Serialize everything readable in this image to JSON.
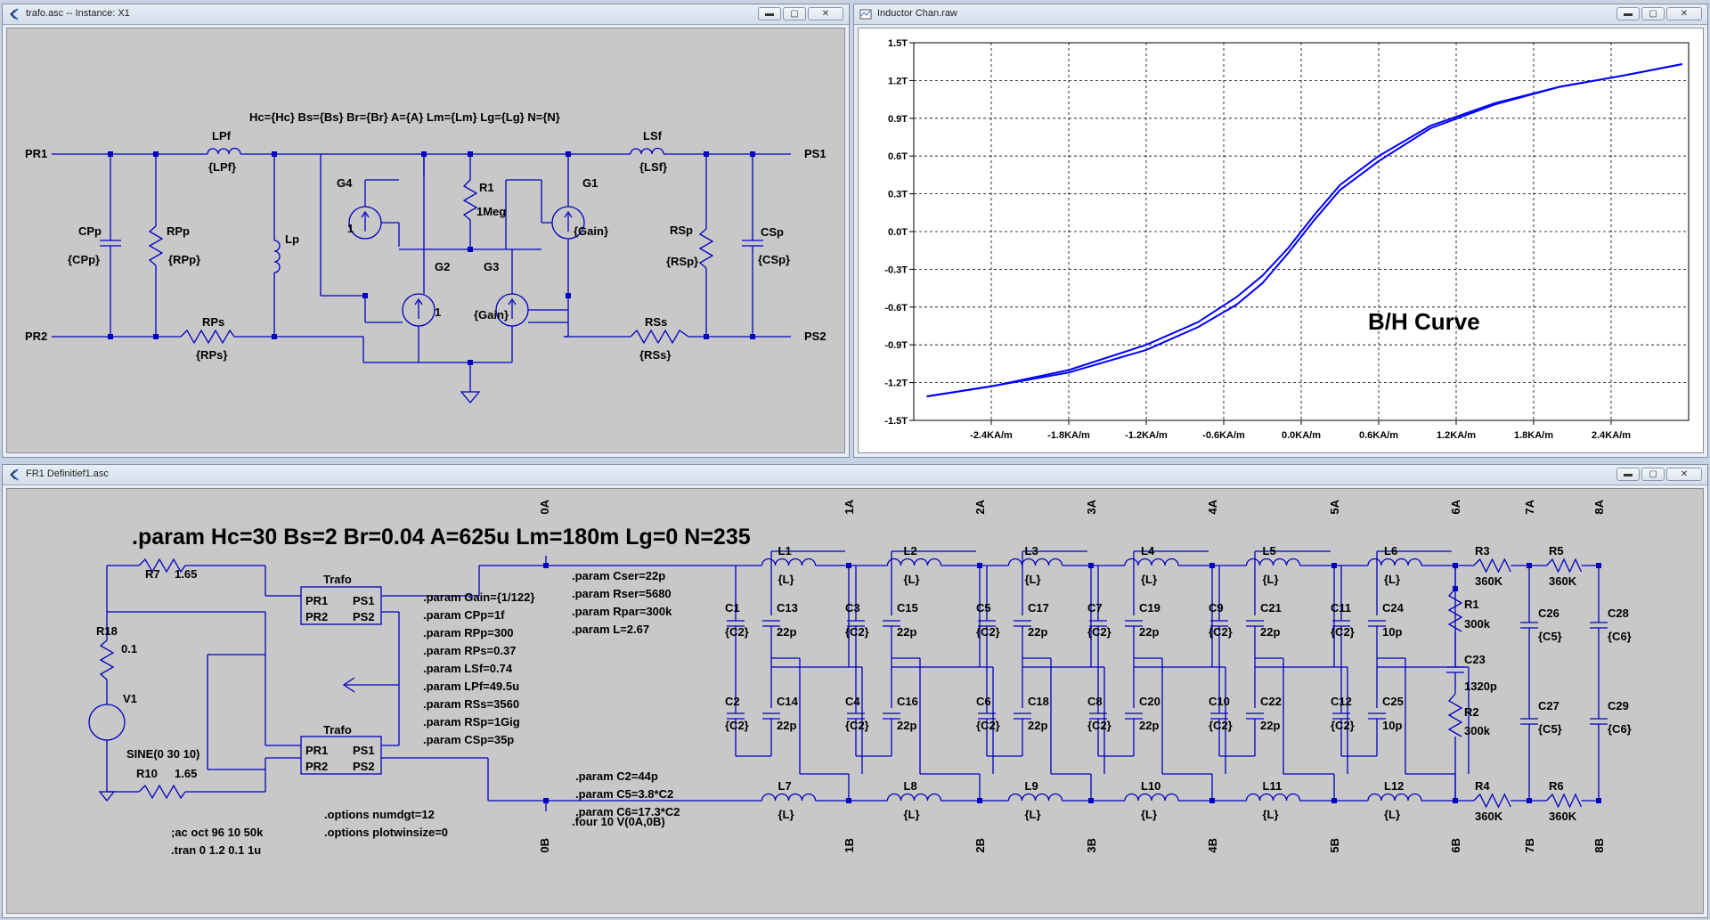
{
  "windows": {
    "trafo": {
      "title": "trafo.asc -- Instance: X1"
    },
    "plot": {
      "title": "Inductor Chan.raw"
    },
    "fr1": {
      "title": "FR1 Definitief1.asc"
    }
  },
  "window_buttons": {
    "minimize": "▬",
    "maximize": "▢",
    "close": "✕"
  },
  "trafo": {
    "header": "Hc={Hc} Bs={Bs} Br={Br} A={A} Lm={Lm} Lg={Lg} N={N}",
    "ports": {
      "pr1": "PR1",
      "pr2": "PR2",
      "ps1": "PS1",
      "ps2": "PS2"
    },
    "LPf": {
      "name": "LPf",
      "value": "{LPf}"
    },
    "LSf": {
      "name": "LSf",
      "value": "{LSf}"
    },
    "CPp": {
      "name": "CPp",
      "value": "{CPp}"
    },
    "RPp": {
      "name": "RPp",
      "value": "{RPp}"
    },
    "Lp": {
      "name": "Lp"
    },
    "RPs": {
      "name": "RPs",
      "value": "{RPs}"
    },
    "RSs": {
      "name": "RSs",
      "value": "{RSs}"
    },
    "RSp": {
      "name": "RSp",
      "value": "{RSp}"
    },
    "CSp": {
      "name": "CSp",
      "value": "{CSp}"
    },
    "R1": {
      "name": "R1",
      "value": "1Meg"
    },
    "G1": {
      "name": "G1",
      "value": "{Gain}"
    },
    "G2": {
      "name": "G2",
      "value": "1"
    },
    "G3": {
      "name": "G3",
      "value": "{Gain}"
    },
    "G4": {
      "name": "G4",
      "value": "1"
    }
  },
  "plot": {
    "annotation": "B/H Curve",
    "annotation_color": "#1fa01f",
    "trace_color": "#0000ff"
  },
  "chart_data": {
    "type": "line",
    "title": "",
    "xlabel": "",
    "ylabel": "",
    "xlim": [
      -3.0,
      3.0
    ],
    "ylim": [
      -1.5,
      1.5
    ],
    "x_unit": "KA/m",
    "y_unit": "T",
    "grid": true,
    "x_ticks": [
      "-2.4KA/m",
      "-1.8KA/m",
      "-1.2KA/m",
      "-0.6KA/m",
      "0.0KA/m",
      "0.6KA/m",
      "1.2KA/m",
      "1.8KA/m",
      "2.4KA/m"
    ],
    "y_ticks": [
      "1.5T",
      "1.2T",
      "0.9T",
      "0.6T",
      "0.3T",
      "0.0T",
      "-0.3T",
      "-0.6T",
      "-0.9T",
      "-1.2T",
      "-1.5T"
    ],
    "series": [
      {
        "x": [
          -2.9,
          -2.4,
          -1.8,
          -1.2,
          -0.8,
          -0.5,
          -0.3,
          -0.1,
          0.0,
          0.1,
          0.3,
          0.6,
          1.0,
          1.5,
          2.0,
          2.5,
          2.95
        ],
        "y": [
          -1.31,
          -1.23,
          -1.1,
          -0.9,
          -0.72,
          -0.52,
          -0.35,
          -0.13,
          0.0,
          0.13,
          0.37,
          0.6,
          0.84,
          1.02,
          1.15,
          1.24,
          1.33
        ]
      },
      {
        "x": [
          -2.9,
          -2.4,
          -1.8,
          -1.2,
          -0.8,
          -0.5,
          -0.3,
          -0.1,
          0.0,
          0.1,
          0.3,
          0.6,
          1.0,
          1.5,
          2.0,
          2.5,
          2.95
        ],
        "y": [
          -1.31,
          -1.23,
          -1.12,
          -0.94,
          -0.76,
          -0.58,
          -0.41,
          -0.17,
          -0.04,
          0.09,
          0.33,
          0.56,
          0.82,
          1.01,
          1.15,
          1.24,
          1.33
        ]
      }
    ]
  },
  "fr1": {
    "param_main": ".param Hc=30 Bs=2 Br=0.04 A=625u Lm=180m Lg=0 N=235",
    "trafo_label": "Trafo",
    "pins": {
      "pr1": "PR1",
      "pr2": "PR2",
      "ps1": "PS1",
      "ps2": "PS2"
    },
    "R7": {
      "name": "R7",
      "value": "1.65"
    },
    "R18": {
      "name": "R18",
      "value": "0.1"
    },
    "V1": {
      "name": "V1",
      "value": "SINE(0 30 10)"
    },
    "R10": {
      "name": "R10",
      "value": "1.65"
    },
    "params_trafo": [
      ".param Gain={1/122}",
      ".param CPp=1f",
      ".param RPp=300",
      ".param RPs=0.37",
      ".param LSf=0.74",
      ".param LPf=49.5u",
      ".param RSs=3560",
      ".param RSp=1Gig",
      ".param CSp=35p"
    ],
    "params_c": [
      ".param Cser=22p",
      ".param Rser=5680",
      ".param Rpar=300k",
      ".param L=2.67"
    ],
    "params_c2": [
      ".param C2=44p",
      ".param C5=3.8*C2",
      ".param C6=17.3*C2"
    ],
    "four": ".four 10 V(0A,0B)",
    "ac": ";ac oct 96 10 50k",
    "tran": ".tran 0 1.2 0.1 1u",
    "opt1": ".options numdgt=12",
    "opt2": ".options plotwinsize=0",
    "nodes_top": [
      "0A",
      "1A",
      "2A",
      "3A",
      "4A",
      "5A",
      "6A",
      "7A",
      "8A"
    ],
    "nodes_bottom": [
      "0B",
      "1B",
      "2B",
      "3B",
      "4B",
      "5B",
      "6B",
      "7B",
      "8B"
    ],
    "L_top": [
      "L1",
      "L2",
      "L3",
      "L4",
      "L5",
      "L6"
    ],
    "L_bot": [
      "L7",
      "L8",
      "L9",
      "L10",
      "L11",
      "L12"
    ],
    "L_value": "{L}",
    "sections": [
      {
        "ca": "C1",
        "cb": "C13",
        "cc": "C2",
        "cd": "C14",
        "va": "{C2}",
        "vb": "22p",
        "vd": "22p"
      },
      {
        "ca": "C3",
        "cb": "C15",
        "cc": "C4",
        "cd": "C16",
        "va": "{C2}",
        "vb": "22p",
        "vd": "22p"
      },
      {
        "ca": "C5",
        "cb": "C17",
        "cc": "C6",
        "cd": "C18",
        "va": "{C2}",
        "vb": "22p",
        "vd": "22p"
      },
      {
        "ca": "C7",
        "cb": "C19",
        "cc": "C8",
        "cd": "C20",
        "va": "{C2}",
        "vb": "22p",
        "vd": "22p"
      },
      {
        "ca": "C9",
        "cb": "C21",
        "cc": "C10",
        "cd": "C22",
        "va": "{C2}",
        "vb": "22p",
        "vd": "22p"
      },
      {
        "ca": "C11",
        "cb": "C24",
        "cc": "C12",
        "cd": "C25",
        "va": "{C2}",
        "vb": "10p",
        "vd": "10p"
      }
    ],
    "R1": {
      "name": "R1",
      "value": "300k"
    },
    "C23": {
      "name": "C23",
      "value": "1320p"
    },
    "R2": {
      "name": "R2",
      "value": "300k"
    },
    "R3": {
      "name": "R3",
      "value": "360K"
    },
    "R4": {
      "name": "R4",
      "value": "360K"
    },
    "R5": {
      "name": "R5",
      "value": "360K"
    },
    "R6": {
      "name": "R6",
      "value": "360K"
    },
    "C26": {
      "name": "C26",
      "value": "{C5}"
    },
    "C27": {
      "name": "C27",
      "value": "{C5}"
    },
    "C28": {
      "name": "C28",
      "value": "{C6}"
    },
    "C29": {
      "name": "C29",
      "value": "{C6}"
    }
  }
}
